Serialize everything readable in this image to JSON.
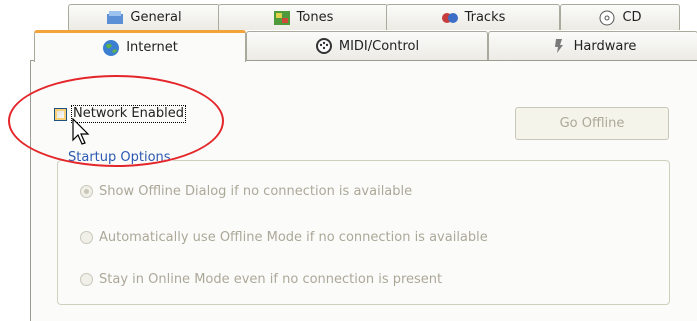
{
  "tabs_row1": [
    {
      "label": "General",
      "icon": "general-icon"
    },
    {
      "label": "Tones",
      "icon": "tones-icon"
    },
    {
      "label": "Tracks",
      "icon": "tracks-icon"
    },
    {
      "label": "CD",
      "icon": "cd-icon"
    }
  ],
  "tabs_row2": [
    {
      "label": "Internet",
      "icon": "globe-icon",
      "active": true
    },
    {
      "label": "MIDI/Control",
      "icon": "midi-icon"
    },
    {
      "label": "Hardware",
      "icon": "hardware-icon"
    }
  ],
  "network_checkbox": {
    "label": "Network Enabled",
    "checked": false
  },
  "go_offline": {
    "label": "Go Offline",
    "enabled": false
  },
  "startup_options": {
    "title": "Startup Options",
    "options": [
      {
        "label": "Show Offline Dialog if no connection is available",
        "selected": true
      },
      {
        "label": "Automatically use Offline Mode if no connection is available",
        "selected": false
      },
      {
        "label": "Stay in Online Mode even if no connection is present",
        "selected": false
      }
    ]
  },
  "colors": {
    "annotation": "#e4262a",
    "active_tab_accent": "#f2a33a",
    "group_title": "#2d5ab3"
  }
}
